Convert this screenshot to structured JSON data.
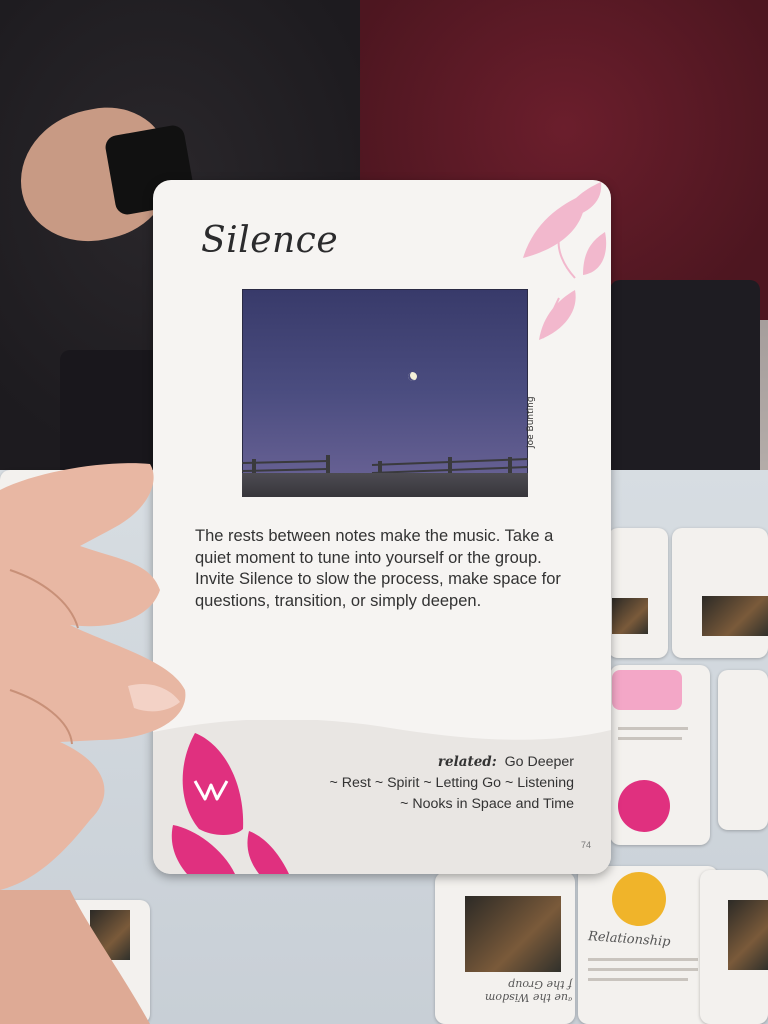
{
  "card": {
    "title": "Silence",
    "photo_credit": "Joe Bunting",
    "body": "The rests between notes make the music. Take a quiet moment to tune into yourself or the group. Invite Silence to slow the process, make space for questions, transition, or simply deepen.",
    "related_label": "related:",
    "related_lines": [
      "Go Deeper",
      "~ Rest ~ Spirit ~ Letting Go ~ Listening",
      "~ Nooks in Space and Time"
    ],
    "page_number": "74",
    "accent_color": "#e0307f",
    "leaf_color": "#f2b8cd"
  },
  "background": {
    "table_cards": [
      {
        "label": "Relationship",
        "symbol_color": "#f0b42a"
      },
      {
        "label": "ᵃue the Wisdom\nf the Group",
        "symbol_color": ""
      }
    ]
  }
}
